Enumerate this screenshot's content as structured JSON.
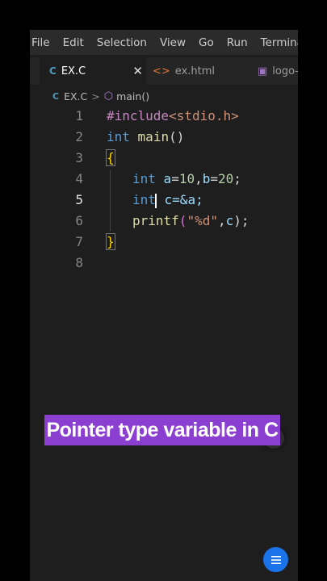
{
  "menu": [
    "File",
    "Edit",
    "Selection",
    "View",
    "Go",
    "Run",
    "Terminal"
  ],
  "tabs": [
    {
      "label": "EX.C",
      "icon": "c-file-icon",
      "close": "✕"
    },
    {
      "label": "ex.html",
      "icon": "html-file-icon"
    },
    {
      "label": "logo-",
      "icon": "image-file-icon"
    }
  ],
  "breadcrumb": {
    "file": "EX.C",
    "sep": ">",
    "symbol": "main()"
  },
  "lines": {
    "n1": "1",
    "n2": "2",
    "n3": "3",
    "n4": "4",
    "n5": "5",
    "n6": "6",
    "n7": "7",
    "n8": "8",
    "l1": {
      "directive": "#include",
      "header": "<stdio.h>"
    },
    "l2": {
      "type": "int",
      "name": "main",
      "parens": "()"
    },
    "l3": {
      "brace": "{"
    },
    "l4": {
      "type": "int",
      "a": "a",
      "eq1": "=",
      "v1": "10",
      "comma": ",",
      "b": "b",
      "eq2": "=",
      "v2": "20",
      "semi": ";"
    },
    "l5": {
      "type_a": "int",
      "type_b": "",
      "rest": " c=&a;"
    },
    "l6": {
      "fn": "printf",
      "open": "(",
      "str": "\"%d\"",
      "comma": ",",
      "c": "c",
      "close": ");"
    },
    "l7": {
      "brace": "}"
    }
  },
  "banner": "Pointer type variable in C",
  "colors": {
    "banner_bg": "#8b3fd1",
    "fab": "#1a73e8",
    "editor_bg": "#1e1e1e"
  }
}
